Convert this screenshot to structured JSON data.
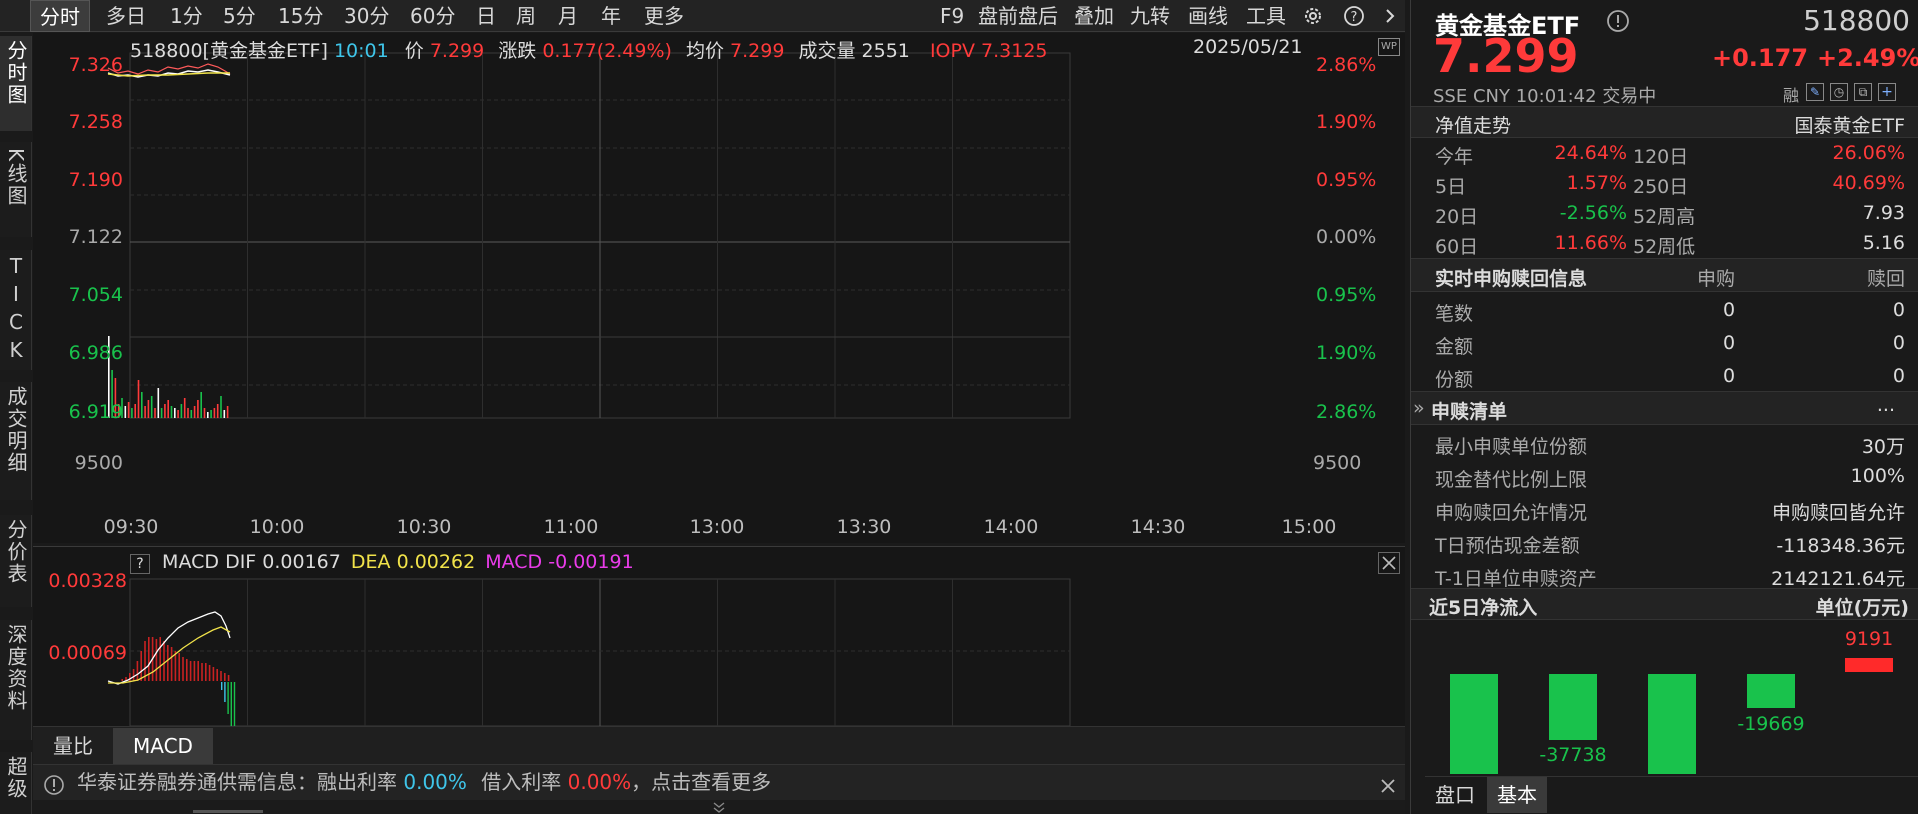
{
  "toolbar": {
    "left_items": [
      "分时",
      "多日",
      "1分",
      "5分",
      "15分",
      "30分",
      "60分",
      "日",
      "周",
      "月",
      "年",
      "更多"
    ],
    "right_items": [
      "F9",
      "盘前盘后",
      "叠加",
      "九转",
      "画线",
      "工具"
    ],
    "selected": "分时"
  },
  "left_tabs": [
    "分时图",
    "K线图",
    "TICK",
    "成交明细",
    "分价表",
    "深度资料",
    "超级"
  ],
  "header": {
    "code_name": "518800[黄金基金ETF]",
    "time": "10:01",
    "price_label": "价",
    "price": "7.299",
    "change_label": "涨跌",
    "change": "0.177(2.49%)",
    "avg_label": "均价",
    "avg": "7.299",
    "volume_label": "成交量",
    "volume": "2551",
    "iopv_label": "IOPV",
    "iopv": "7.3125",
    "date": "2025/05/21"
  },
  "price_axis": {
    "left": [
      "7.326",
      "7.258",
      "7.190",
      "7.122",
      "7.054",
      "6.986",
      "6.919"
    ],
    "right": [
      "2.86%",
      "1.90%",
      "0.95%",
      "0.00%",
      "0.95%",
      "1.90%",
      "2.86%"
    ],
    "vol_left": "9500",
    "vol_right": "9500",
    "x_ticks": [
      "09:30",
      "10:00",
      "10:30",
      "11:00",
      "13:00",
      "13:30",
      "14:00",
      "14:30",
      "15:00"
    ]
  },
  "macd": {
    "help": "?",
    "title": "MACD",
    "dif_label": "DIF",
    "dif": "0.00167",
    "dea_label": "DEA",
    "dea": "0.00262",
    "macd_label": "MACD",
    "macd": "-0.00191",
    "y_ticks": [
      "0.00328",
      "0.00069"
    ]
  },
  "bottom_tabs": [
    "量比",
    "MACD"
  ],
  "bottom_tab_selected": "MACD",
  "notice": {
    "prefix": "华泰证券融券通供需信息：融出利率",
    "lend_rate": "0.00%",
    "mid": "借入利率",
    "borrow_rate": "0.00%",
    "suffix": "，点击查看更多"
  },
  "quote": {
    "name": "黄金基金ETF",
    "code": "518800",
    "price": "7.299",
    "change": "+0.177",
    "change_pct": "+2.49%",
    "exchange": "SSE",
    "currency": "CNY",
    "time": "10:01:42",
    "status": "交易中",
    "rong": "融"
  },
  "nav": {
    "title": "净值走势",
    "company": "国泰黄金ETF",
    "rows": [
      {
        "l1": "今年",
        "v1": "24.64%",
        "l2": "120日",
        "v2": "26.06%"
      },
      {
        "l1": "5日",
        "v1": "1.57%",
        "l2": "250日",
        "v2": "40.69%"
      },
      {
        "l1": "20日",
        "v1": "-2.56%",
        "l2": "52周高",
        "v2": "7.93"
      },
      {
        "l1": "60日",
        "v1": "11.66%",
        "l2": "52周低",
        "v2": "5.16"
      }
    ]
  },
  "subscribe": {
    "title": "实时申购赎回信息",
    "col1": "申购",
    "col2": "赎回",
    "rows": [
      {
        "label": "笔数",
        "buy": "0",
        "sell": "0"
      },
      {
        "label": "金额",
        "buy": "0",
        "sell": "0"
      },
      {
        "label": "份额",
        "buy": "0",
        "sell": "0"
      }
    ]
  },
  "list": {
    "title": "申赎清单",
    "more": "...",
    "rows": [
      {
        "label": "最小申赎单位份额",
        "value": "30万"
      },
      {
        "label": "现金替代比例上限",
        "value": "100%"
      },
      {
        "label": "申购赎回允许情况",
        "value": "申购赎回皆允许"
      },
      {
        "label": "T日预估现金差额",
        "value": "-118348.36元"
      },
      {
        "label": "T-1日单位申赎资产",
        "value": "2142121.64元"
      }
    ]
  },
  "inflow": {
    "title": "近5日净流入",
    "unit": "单位(万元)",
    "labels": [
      "-37738",
      "-19669",
      "9191"
    ]
  },
  "bottom_right_tabs": [
    "盘口",
    "基本"
  ],
  "bottom_right_selected": "基本",
  "colors": {
    "up": "#ff3a3a",
    "down": "#19c24c",
    "accent_cyan": "#3fc5e9",
    "grid": "#3a3a3a"
  }
}
